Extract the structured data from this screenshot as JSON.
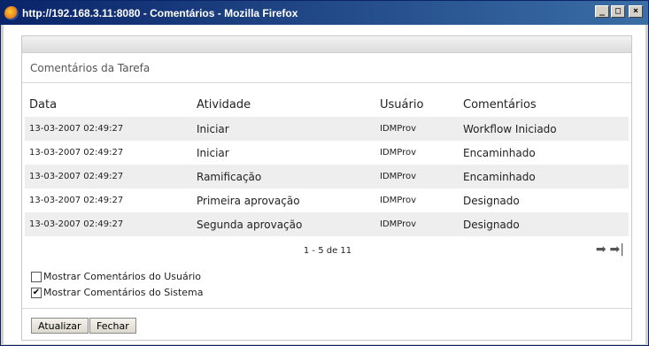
{
  "window": {
    "title": "http://192.168.3.11:8080 - Comentários - Mozilla Firefox",
    "minimize_label": "_",
    "maximize_label": "□",
    "close_label": "×"
  },
  "panel": {
    "title": "Comentários da Tarefa"
  },
  "table": {
    "headers": {
      "data": "Data",
      "atividade": "Atividade",
      "usuario": "Usuário",
      "comentarios": "Comentários"
    },
    "rows": [
      {
        "data": "13-03-2007 02:49:27",
        "atividade": "Iniciar",
        "usuario": "IDMProv",
        "comentarios": "Workflow Iniciado"
      },
      {
        "data": "13-03-2007 02:49:27",
        "atividade": "Iniciar",
        "usuario": "IDMProv",
        "comentarios": "Encaminhado"
      },
      {
        "data": "13-03-2007 02:49:27",
        "atividade": "Ramificação",
        "usuario": "IDMProv",
        "comentarios": "Encaminhado"
      },
      {
        "data": "13-03-2007 02:49:27",
        "atividade": "Primeira aprovação",
        "usuario": "IDMProv",
        "comentarios": "Designado"
      },
      {
        "data": "13-03-2007 02:49:27",
        "atividade": "Segunda aprovação",
        "usuario": "IDMProv",
        "comentarios": "Designado"
      }
    ]
  },
  "pagination": {
    "text": "1 - 5 de 11",
    "next_icon": "arrow-right-icon",
    "last_icon": "arrow-last-icon"
  },
  "options": {
    "show_user_comments": {
      "label": "Mostrar Comentários do Usuário",
      "checked": false
    },
    "show_system_comments": {
      "label": "Mostrar Comentários do Sistema",
      "checked": true
    }
  },
  "buttons": {
    "refresh": "Atualizar",
    "close": "Fechar"
  }
}
